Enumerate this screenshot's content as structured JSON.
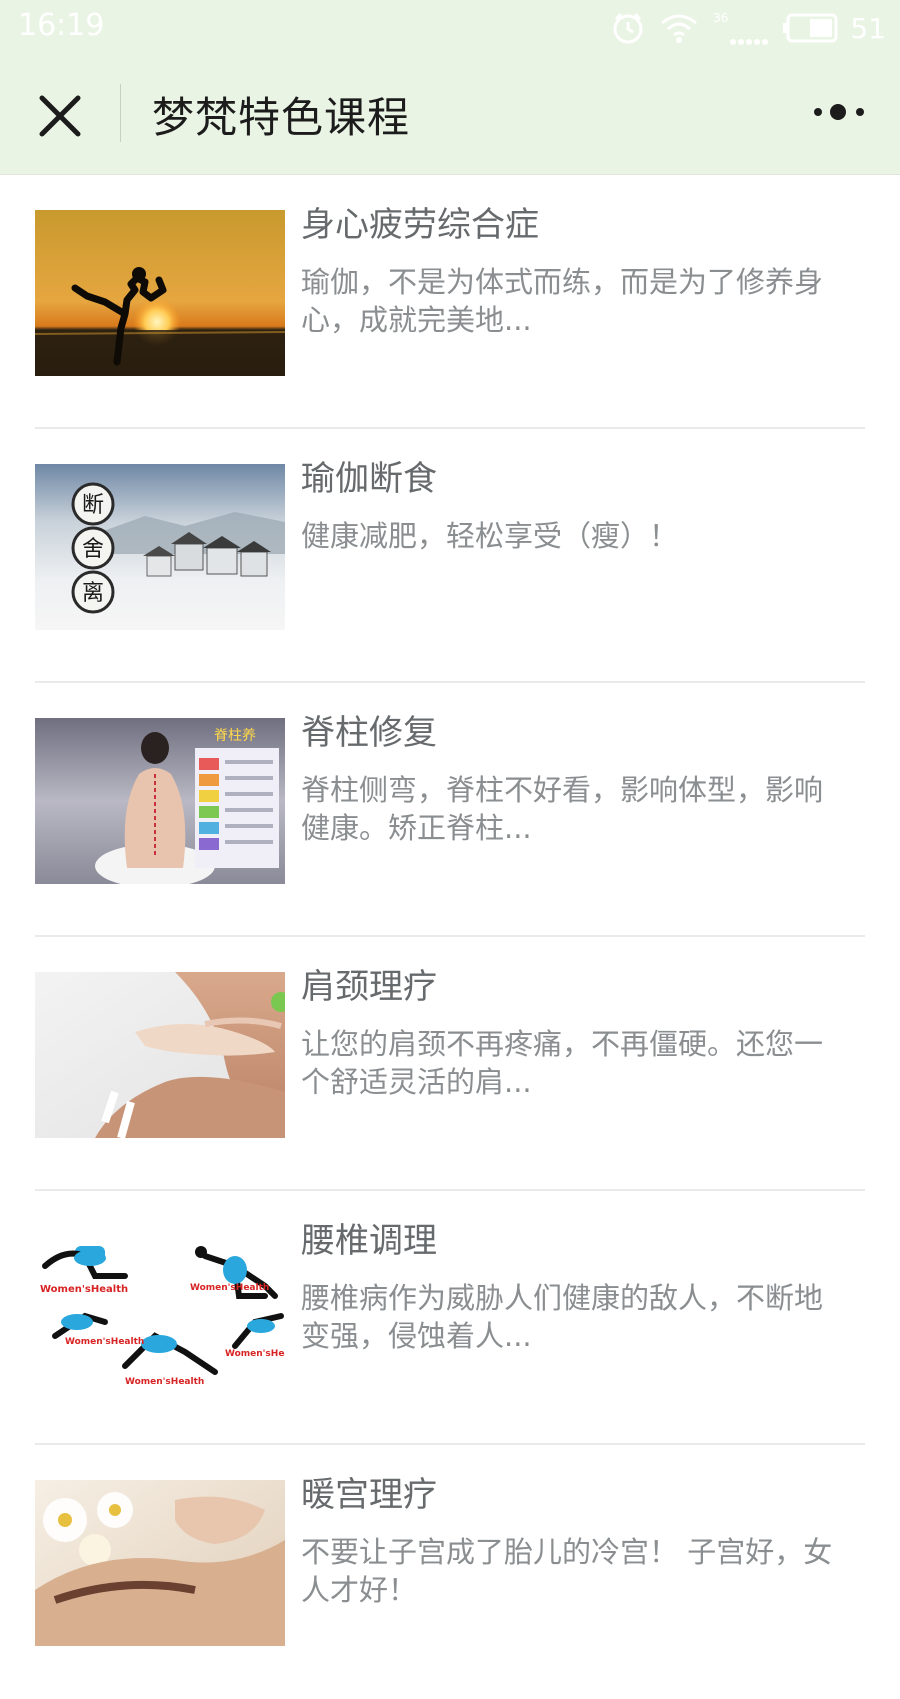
{
  "status_bar": {
    "time": "16:19",
    "network": "36",
    "battery": "51",
    "icons": [
      "alarm-icon",
      "wifi-icon",
      "signal-icon",
      "battery-icon"
    ]
  },
  "nav": {
    "title": "梦梵特色课程",
    "close_icon": "close-icon",
    "more_icon": "more-icon",
    "background": "#eaf4e4"
  },
  "courses": [
    {
      "title": "身心疲劳综合症",
      "description": "瑜伽，不是为体式而练，而是为了修养身心，成就完美地...",
      "thumb": "yoga-sunset-silhouette-image"
    },
    {
      "title": "瑜伽断食",
      "description": "健康减肥，轻松享受（瘦）！",
      "thumb": "misty-village-image",
      "thumb_text": [
        "断",
        "舍",
        "离"
      ]
    },
    {
      "title": "脊柱修复",
      "description": "脊柱侧弯，脊柱不好看，影响体型，影响健康。矫正脊柱...",
      "thumb": "spine-chart-image",
      "thumb_text": [
        "脊柱养"
      ]
    },
    {
      "title": "肩颈理疗",
      "description": "让您的肩颈不再疼痛，不再僵硬。还您一个舒适灵活的肩...",
      "thumb": "neck-massage-image"
    },
    {
      "title": "腰椎调理",
      "description": "腰椎病作为威胁人们健康的敌人，不断地变强，侵蚀着人...",
      "thumb": "yoga-poses-image",
      "thumb_text": [
        "Women'sHealth"
      ]
    },
    {
      "title": "暖宫理疗",
      "description": "不要让子宫成了胎儿的冷宫！ 子宫好，女人才好！",
      "thumb": "flower-woman-image"
    }
  ]
}
